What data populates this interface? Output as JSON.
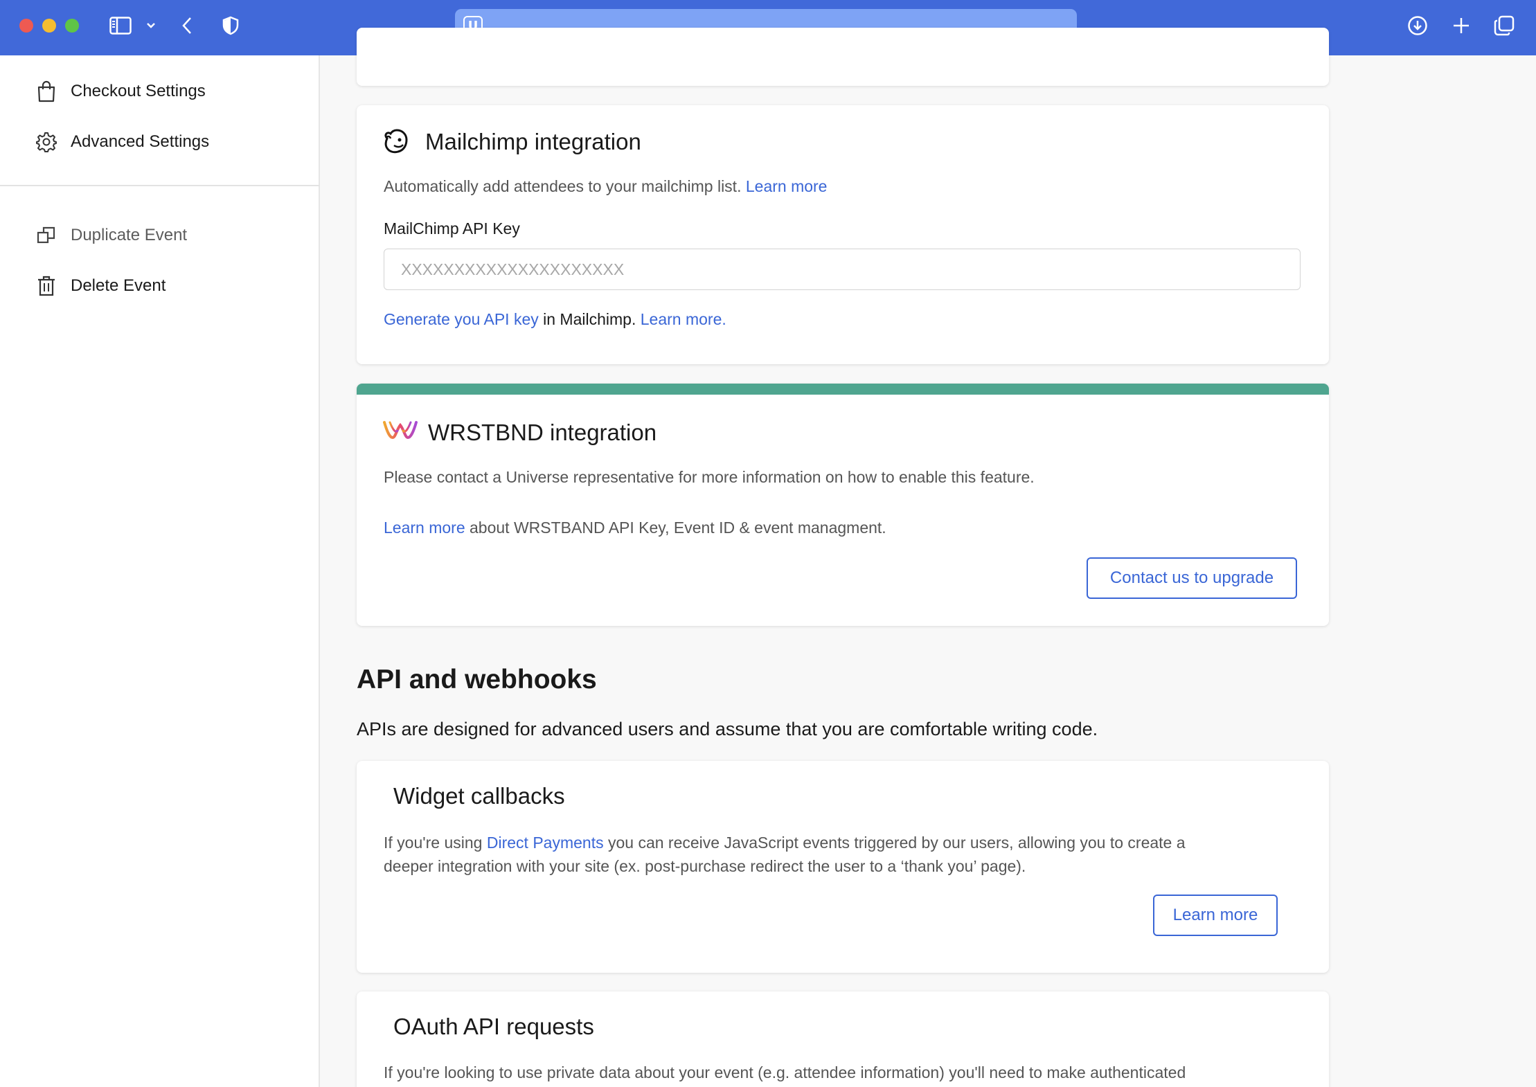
{
  "browser": {
    "url_text": "",
    "favicon_letter": "U"
  },
  "sidebar": {
    "top_items": [
      {
        "label": "Checkout Settings",
        "icon": "shopping-bag-icon"
      },
      {
        "label": "Advanced Settings",
        "icon": "gear-icon"
      }
    ],
    "bottom_items": [
      {
        "label": "Duplicate Event",
        "icon": "duplicate-icon"
      },
      {
        "label": "Delete Event",
        "icon": "trash-icon"
      }
    ]
  },
  "mailchimp": {
    "title": "Mailchimp integration",
    "description": "Automatically add attendees to your mailchimp list.",
    "learn_more": "Learn more",
    "api_key_label": "MailChimp API Key",
    "api_key_placeholder": "XXXXXXXXXXXXXXXXXXXXX",
    "generate_link": "Generate you API key",
    "generate_suffix": " in Mailchimp.",
    "learn_more_2": "Learn more."
  },
  "wrstbnd": {
    "title": "WRSTBND integration",
    "description": "Please contact a Universe representative for more information on how to enable this feature.",
    "learn_more": "Learn more",
    "learn_more_suffix": " about WRSTBAND API Key, Event ID & event managment.",
    "upgrade_button": "Contact us to upgrade",
    "accent_color": "#4fa58f"
  },
  "api_section": {
    "heading": "API and webhooks",
    "subheading": "APIs are designed for advanced users and assume that you are comfortable writing code."
  },
  "widget_callbacks": {
    "title": "Widget callbacks",
    "text_prefix": "If you're using ",
    "direct_payments_link": "Direct Payments",
    "text_suffix_line1": " you can receive JavaScript events triggered by our users, allowing you to create a",
    "text_line2": "deeper integration with your site (ex. post-purchase redirect the user to a ‘thank you’ page).",
    "button": "Learn more"
  },
  "oauth": {
    "title": "OAuth API requests",
    "text": "If you're looking to use private data about your event (e.g. attendee information) you'll need to make authenticated"
  },
  "colors": {
    "toolbar": "#4169d9",
    "link": "#3a66d6"
  }
}
